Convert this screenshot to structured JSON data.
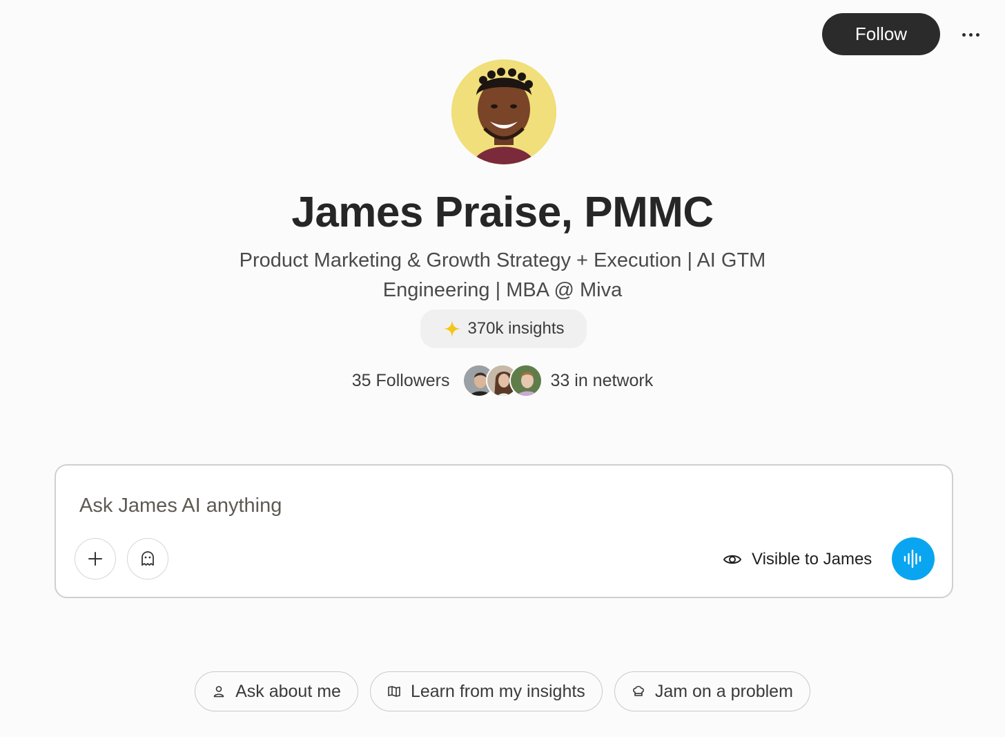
{
  "header": {
    "follow_label": "Follow"
  },
  "profile": {
    "name": "James Praise, PMMC",
    "headline_line1": "Product Marketing & Growth Strategy + Execution | AI GTM",
    "headline_line2": "Engineering | MBA @ Miva",
    "insights_label": "370k insights",
    "followers_label": "35 Followers",
    "network_label": "33 in network",
    "avatar_bg": "#f0df7a"
  },
  "ask": {
    "placeholder": "Ask James AI anything",
    "visibility_label": "Visible to James",
    "accent": "#0aa5f0"
  },
  "suggestions": [
    {
      "label": "Ask about me",
      "icon": "person-icon"
    },
    {
      "label": "Learn from my insights",
      "icon": "book-icon"
    },
    {
      "label": "Jam on a problem",
      "icon": "chef-hat-icon"
    }
  ]
}
